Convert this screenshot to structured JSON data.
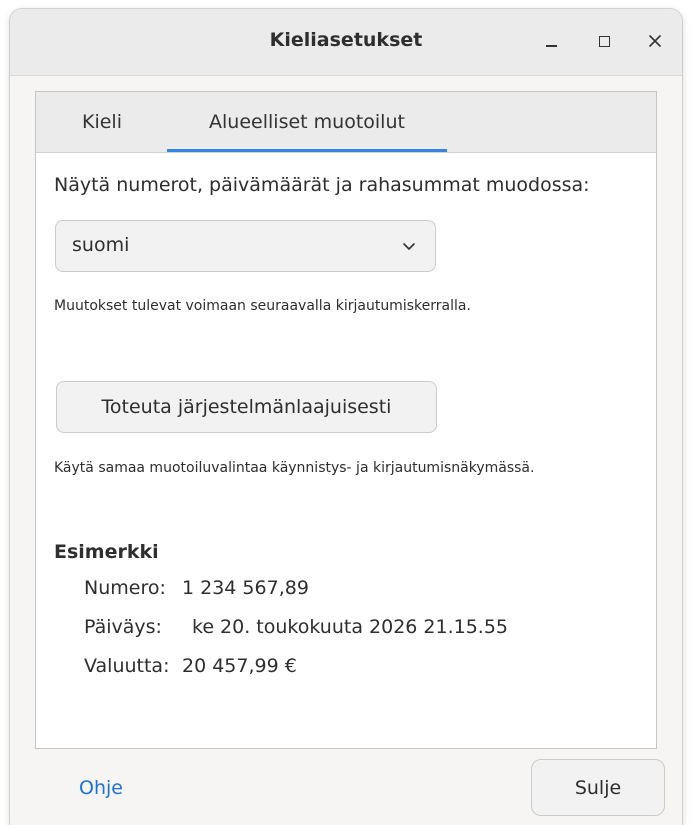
{
  "window": {
    "title": "Kieliasetukset"
  },
  "tabs": [
    {
      "label": "Kieli",
      "active": false
    },
    {
      "label": "Alueelliset muotoilut",
      "active": true
    }
  ],
  "formats": {
    "prompt": "Näytä numerot, päivämäärät ja rahasummat muodossa:",
    "selected": "suomi",
    "note_login": "Muutokset tulevat voimaan seuraavalla kirjautumiskerralla.",
    "apply_label": "Toteuta järjestelmänlaajuisesti",
    "note_system": "Käytä samaa muotoiluvalintaa käynnistys- ja kirjautumisnäkymässä."
  },
  "example": {
    "title": "Esimerkki",
    "number_label": "Numero:",
    "number_value": "1 234 567,89",
    "date_label": "Päiväys:",
    "date_value": "ke 20. toukokuuta 2026 21.15.55",
    "currency_label": "Valuutta:",
    "currency_value": "20 457,99 €"
  },
  "footer": {
    "help_label": "Ohje",
    "close_label": "Sulje"
  },
  "colors": {
    "accent": "#3584e4",
    "link": "#1c71d8"
  },
  "icons": {
    "minimize": "minimize-icon",
    "maximize": "maximize-icon",
    "close": "close-icon",
    "dropdown": "chevron-down-icon"
  }
}
